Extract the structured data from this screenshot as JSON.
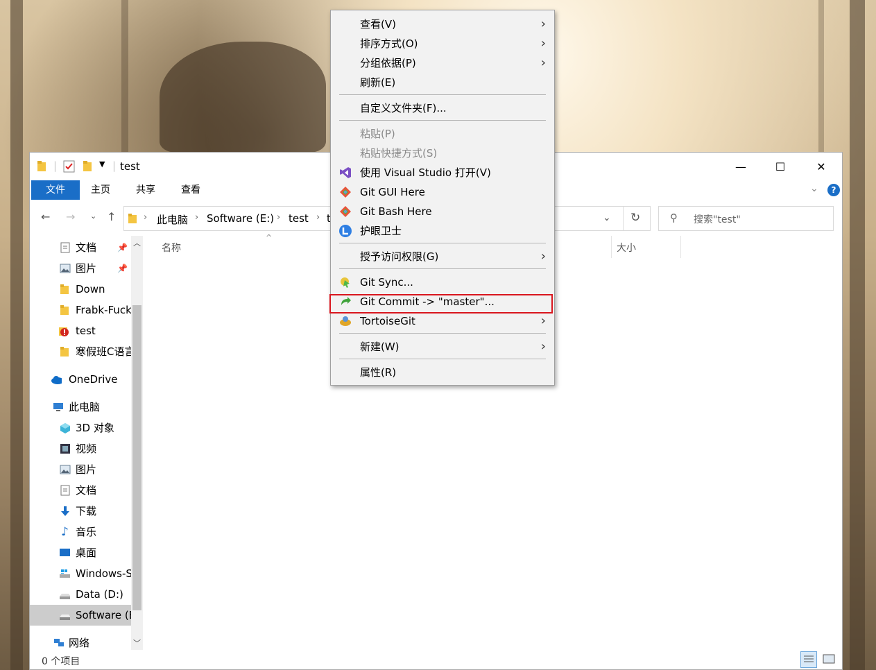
{
  "window": {
    "title": "test",
    "minimize_glyph": "—",
    "maximize_glyph": "☐",
    "close_glyph": "✕"
  },
  "ribbon": {
    "tabs": [
      "文件",
      "主页",
      "共享",
      "查看"
    ]
  },
  "address": {
    "crumbs": [
      "此电脑",
      "Software (E:)",
      "test",
      "t"
    ],
    "search_placeholder": "搜索\"test\""
  },
  "sidebar": {
    "items": [
      {
        "label": "文档",
        "icon": "document-icon",
        "pinned": true
      },
      {
        "label": "图片",
        "icon": "picture-icon",
        "pinned": true
      },
      {
        "label": "Down",
        "icon": "folder-icon"
      },
      {
        "label": "Frabk-Fuck",
        "icon": "folder-icon"
      },
      {
        "label": "test",
        "icon": "git-conflict-icon"
      },
      {
        "label": "寒假班C语言",
        "icon": "folder-icon"
      },
      {
        "label": "OneDrive",
        "icon": "cloud-icon"
      },
      {
        "label": "此电脑",
        "icon": "computer-icon"
      },
      {
        "label": "3D 对象",
        "icon": "cube-icon"
      },
      {
        "label": "视频",
        "icon": "video-icon"
      },
      {
        "label": "图片",
        "icon": "picture-icon"
      },
      {
        "label": "文档",
        "icon": "document-icon"
      },
      {
        "label": "下载",
        "icon": "download-icon"
      },
      {
        "label": "音乐",
        "icon": "music-icon"
      },
      {
        "label": "桌面",
        "icon": "desktop-icon"
      },
      {
        "label": "Windows-S",
        "icon": "windows-drive-icon"
      },
      {
        "label": "Data (D:)",
        "icon": "drive-icon"
      },
      {
        "label": "Software (E",
        "icon": "drive-icon"
      },
      {
        "label": "网络",
        "icon": "network-icon"
      }
    ]
  },
  "columns": {
    "name": "名称",
    "size": "大小"
  },
  "status": {
    "text": "0 个项目"
  },
  "menu": {
    "items": [
      {
        "label": "查看(V)",
        "submenu": true
      },
      {
        "label": "排序方式(O)",
        "submenu": true
      },
      {
        "label": "分组依据(P)",
        "submenu": true
      },
      {
        "label": "刷新(E)"
      },
      {
        "label": "自定义文件夹(F)..."
      },
      {
        "label": "粘贴(P)",
        "disabled": true
      },
      {
        "label": "粘贴快捷方式(S)",
        "disabled": true
      },
      {
        "label": "使用 Visual Studio 打开(V)",
        "icon": "visual-studio-icon"
      },
      {
        "label": "Git GUI Here",
        "icon": "git-gui-icon"
      },
      {
        "label": "Git Bash Here",
        "icon": "git-bash-icon"
      },
      {
        "label": "护眼卫士",
        "icon": "eye-guard-icon"
      },
      {
        "label": "授予访问权限(G)",
        "submenu": true
      },
      {
        "label": "Git Sync...",
        "icon": "git-sync-icon"
      },
      {
        "label": "Git Commit -> \"master\"...",
        "icon": "git-commit-icon"
      },
      {
        "label": "TortoiseGit",
        "icon": "tortoisegit-icon",
        "submenu": true
      },
      {
        "label": "新建(W)",
        "submenu": true
      },
      {
        "label": "属性(R)"
      }
    ]
  },
  "colors": {
    "accent": "#1a6ec7",
    "highlight_border": "#d9161e"
  }
}
